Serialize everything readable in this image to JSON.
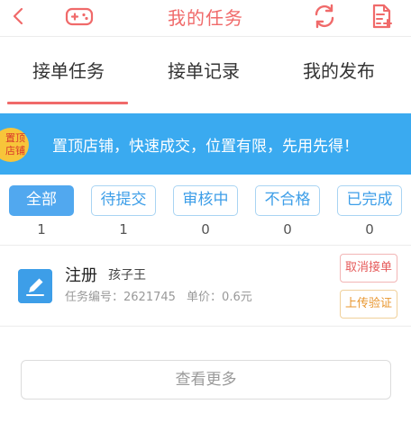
{
  "header": {
    "title": "我的任务",
    "icons": {
      "back": "chevron-left-icon",
      "game": "gamepad-icon",
      "refresh": "refresh-icon",
      "document": "document-add-icon"
    }
  },
  "tabs": [
    {
      "label": "接单任务",
      "active": true
    },
    {
      "label": "接单记录",
      "active": false
    },
    {
      "label": "我的发布",
      "active": false
    }
  ],
  "banner": {
    "badge_line1": "置顶",
    "badge_line2": "店铺",
    "text": "置顶店铺，快速成交，位置有限，先用先得！"
  },
  "filters": [
    {
      "label": "全部",
      "count": "1",
      "active": true
    },
    {
      "label": "待提交",
      "count": "1",
      "active": false
    },
    {
      "label": "审核中",
      "count": "0",
      "active": false
    },
    {
      "label": "不合格",
      "count": "0",
      "active": false
    },
    {
      "label": "已完成",
      "count": "0",
      "active": false
    }
  ],
  "task": {
    "name": "注册",
    "user": "孩子王",
    "number": "任务编号：2621745",
    "price": "单价：0.6元",
    "cancel_label": "取消接单",
    "upload_label": "上传验证"
  },
  "load_more_label": "查看更多",
  "colors": {
    "accent_red": "#f06a6a",
    "accent_blue": "#3d9ee8",
    "banner_blue": "#3aaaf0",
    "badge_yellow": "#f7c53a",
    "upload_orange": "#e8962e"
  }
}
